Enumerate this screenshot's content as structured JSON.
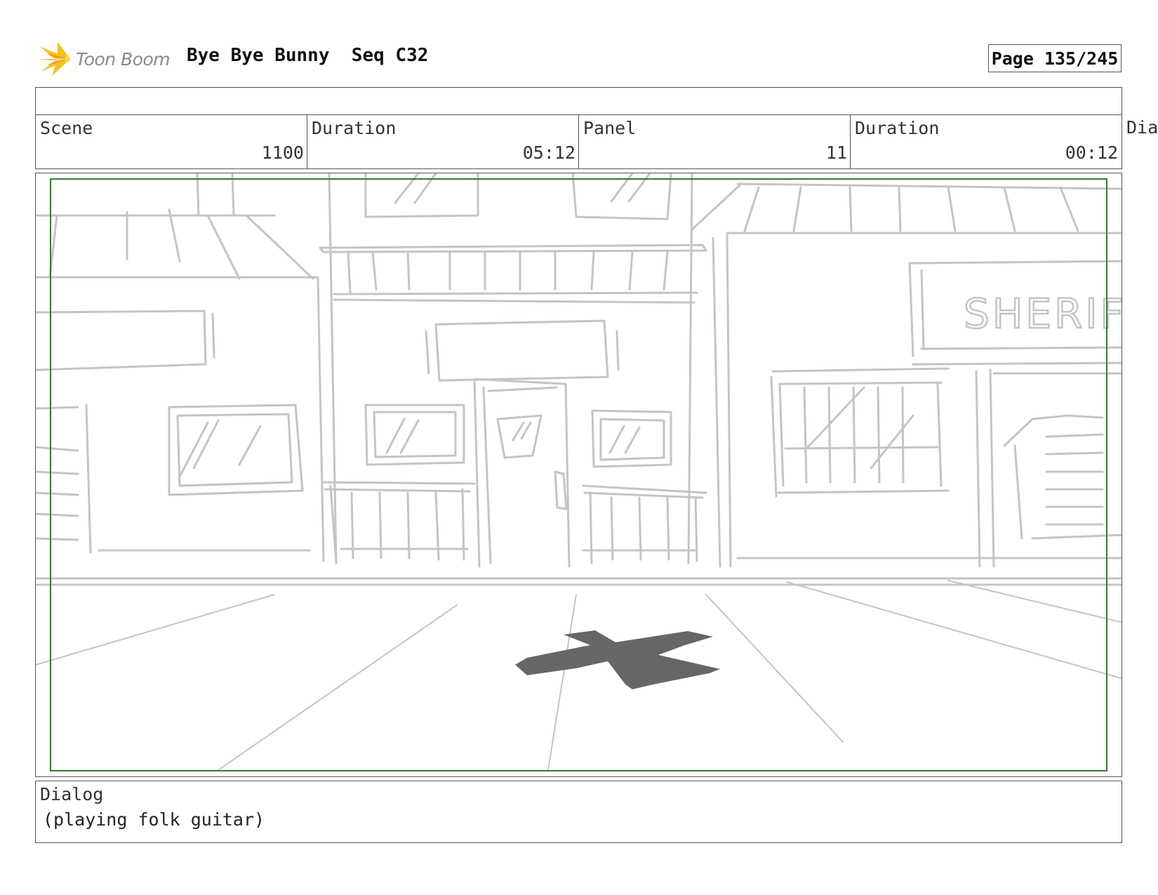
{
  "header": {
    "brand": "Toon Boom",
    "title": "Bye Bye Bunny  Seq C32",
    "page": "Page 135/245"
  },
  "info": {
    "scene_label": "Scene",
    "scene_value": "1100",
    "scene_duration_label": "Duration",
    "scene_duration_value": "05:12",
    "panel_label": "Panel",
    "panel_value": "11",
    "panel_duration_label": "Duration",
    "panel_duration_value": "00:12",
    "overflow_label": "Dia"
  },
  "panel": {
    "sign_text": "SHERIF",
    "frame_color": "#2e7d32",
    "sketch_color": "#c4c4c4",
    "shadow_color": "#666666"
  },
  "dialog": {
    "label": "Dialog",
    "text": "(playing folk guitar)"
  }
}
